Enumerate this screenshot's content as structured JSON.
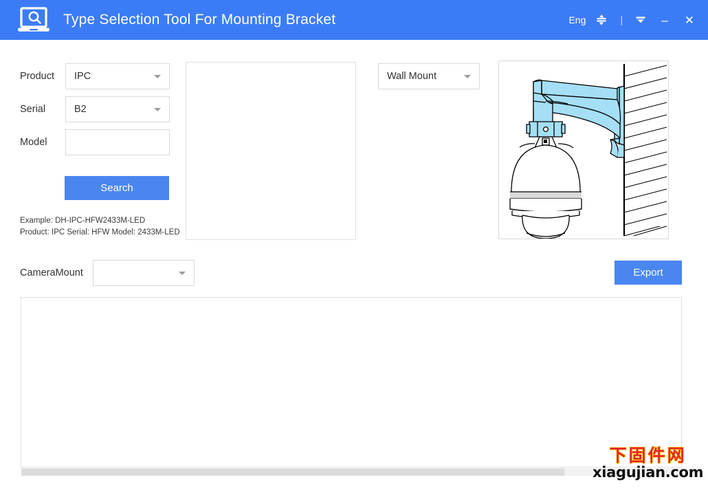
{
  "window": {
    "title": "Type Selection Tool For Mounting Bracket",
    "logo_icon": "laptop-search-icon",
    "titlebar_color": "#3b7cf6",
    "controls": {
      "language_label": "Eng",
      "language_switch_icon": "swap-vertical-icon",
      "separator": "|",
      "menu_icon": "chevron-down-filled-icon",
      "minimize_icon": "minimize-icon",
      "minimize_glyph": "–",
      "close_icon": "close-icon",
      "close_glyph": "✕"
    }
  },
  "form": {
    "product": {
      "label": "Product",
      "value": "IPC",
      "caret_icon": "chevron-down-icon"
    },
    "serial": {
      "label": "Serial",
      "value": "B2",
      "caret_icon": "chevron-down-icon"
    },
    "model": {
      "label": "Model",
      "value": "",
      "placeholder": ""
    },
    "search_button": {
      "label": "Search",
      "color": "#4a86f0"
    },
    "example_line1": "Example: DH-IPC-HFW2433M-LED",
    "example_line2": "Product: IPC Serial: HFW Model: 2433M-LED"
  },
  "model_list": {
    "items": []
  },
  "mount_type": {
    "value": "Wall Mount",
    "caret_icon": "chevron-down-icon"
  },
  "illustration": {
    "name": "ptz-dome-camera-wall-mount-diagram",
    "bracket_color": "#a5dff5",
    "line_color": "#000000",
    "wall_hatch": true
  },
  "camera_mount": {
    "label": "CameraMount",
    "value": "",
    "caret_icon": "chevron-down-icon"
  },
  "export_button": {
    "label": "Export",
    "color": "#4a86f0"
  },
  "results": {
    "columns": [],
    "rows": [],
    "scrollbar": {
      "orientation": "horizontal",
      "thumb_fraction": 0.82
    }
  },
  "watermark": {
    "cn_text": "下固件网",
    "url_text": "xiagujian.com",
    "cn_color": "#e8262a",
    "cn_stroke_color": "#ffd400",
    "url_color": "#111111"
  }
}
